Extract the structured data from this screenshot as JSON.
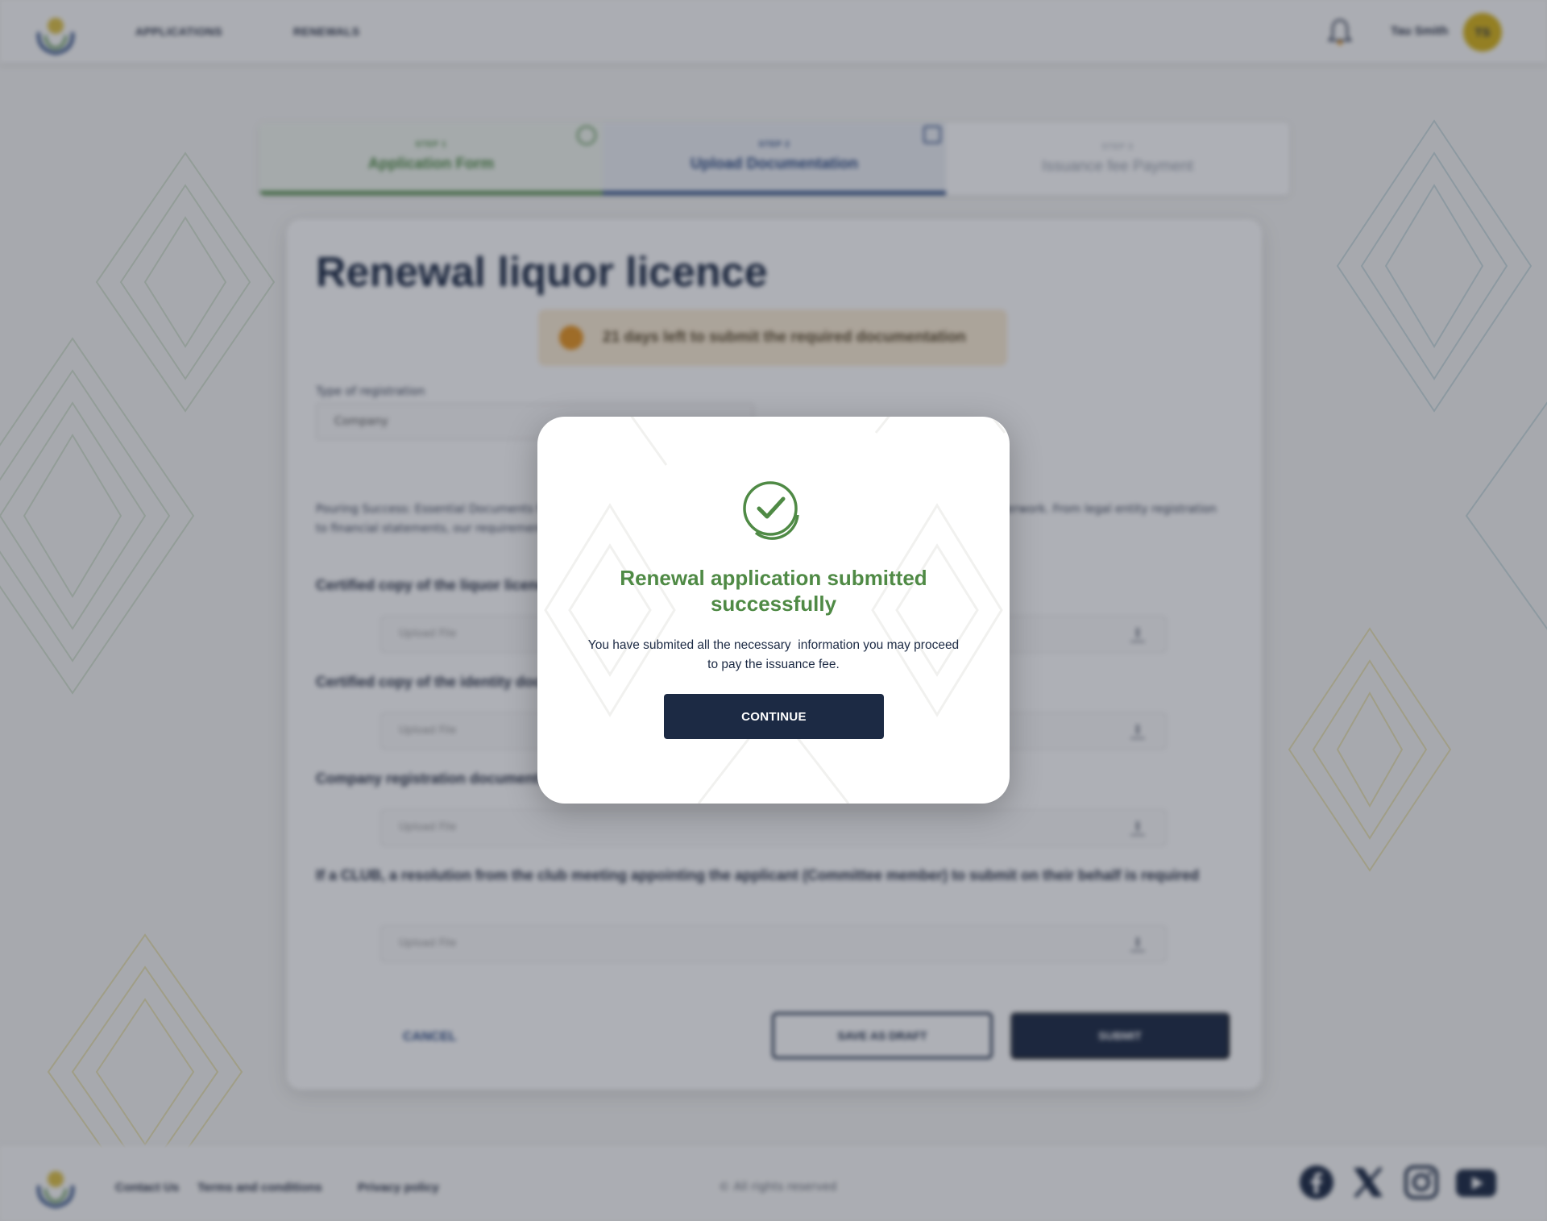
{
  "header": {
    "nav": [
      {
        "label": "APPLICATIONS"
      },
      {
        "label": "RENEWALS"
      }
    ],
    "user": {
      "name": "Tau Smith",
      "initials": "TS"
    }
  },
  "stepper": [
    {
      "step": "STEP 1",
      "title": "Application Form",
      "state": "complete"
    },
    {
      "step": "STEP 2",
      "title": "Upload Documentation",
      "state": "active"
    },
    {
      "step": "STEP 3",
      "title": "Issuance fee Payment",
      "state": "pending"
    }
  ],
  "form": {
    "title": "Renewal liquor licence",
    "deadline": "21 days left to submit the required documentation",
    "registration_type_label": "Type of registration",
    "registration_type_value": "Company",
    "intro": "Pouring Success: Essential Documents for your liquor licence. Streamline your application by preparing the necessary paperwork. From legal entity registration to financial statements, our requirements ensure compliance and prosperity - submit your paperwork today!",
    "documents": [
      {
        "label": "Certified copy of the liquor licence",
        "placeholder": "Upload File"
      },
      {
        "label": "Certified copy of the identity document",
        "placeholder": "Upload File"
      },
      {
        "label": "Company registration documents",
        "placeholder": "Upload File"
      },
      {
        "label": "If a CLUB, a resolution from the club meeting appointing the applicant (Committee member) to submit on their behalf is required",
        "placeholder": "Upload File"
      }
    ],
    "cancel_label": "CANCEL",
    "draft_label": "SAVE AS DRAFT",
    "submit_label": "SUBMIT"
  },
  "footer": {
    "links": [
      "Contact Us",
      "Terms and conditions",
      "Privacy policy"
    ],
    "copyright": "© All rights reserved",
    "social": [
      "facebook-icon",
      "x-icon",
      "instagram-icon",
      "youtube-icon"
    ]
  },
  "modal": {
    "title": "Renewal application submitted successfully",
    "message": "You have submited all the necessary  information you may proceed to pay the issuance fee.",
    "button_label": "CONTINUE",
    "icon": "check-circle-icon"
  },
  "colors": {
    "primary": "#1c2a44",
    "success": "#4f8a45",
    "warning": "#e79522",
    "accent_gold": "#d6b319"
  }
}
